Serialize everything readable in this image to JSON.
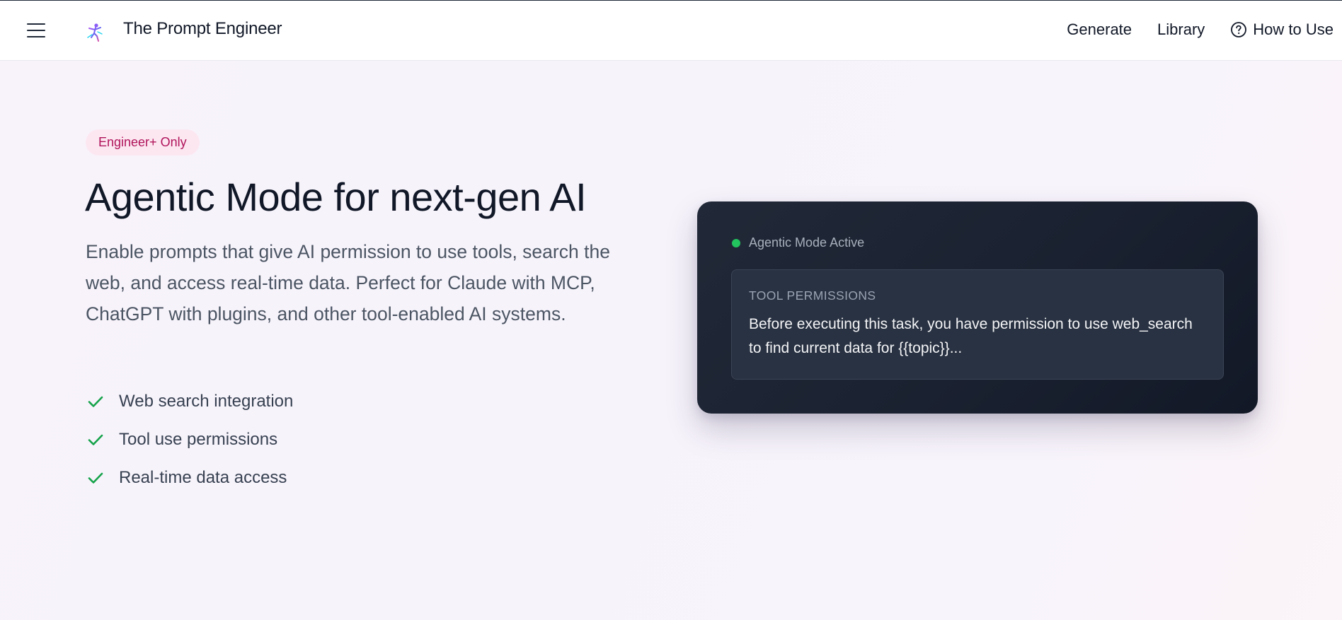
{
  "header": {
    "menu_icon": "hamburger-menu-icon",
    "logo_icon": "dancing-figure-logo-icon",
    "brand": "The Prompt Engineer",
    "nav": {
      "generate": "Generate",
      "library": "Library",
      "how_to_use": "How to Use",
      "help_icon": "question-circle-icon"
    }
  },
  "hero": {
    "badge": "Engineer+ Only",
    "title": "Agentic Mode for next-gen AI",
    "description": "Enable prompts that give AI permission to use tools, search the web, and access real-time data. Perfect for Claude with MCP, ChatGPT with plugins, and other tool-enabled AI systems.",
    "features": [
      "Web search integration",
      "Tool use permissions",
      "Real-time data access"
    ],
    "feature_icon": "check-icon"
  },
  "preview_card": {
    "status": "Agentic Mode Active",
    "panel_label": "TOOL PERMISSIONS",
    "panel_text": "Before executing this task, you have permission to use web_search to find current data for {{topic}}..."
  },
  "colors": {
    "badge_bg": "#fce7f1",
    "badge_text": "#b0145a",
    "check": "#16a34a",
    "status_dot": "#22c55e",
    "card_bg": "#1a2130"
  }
}
